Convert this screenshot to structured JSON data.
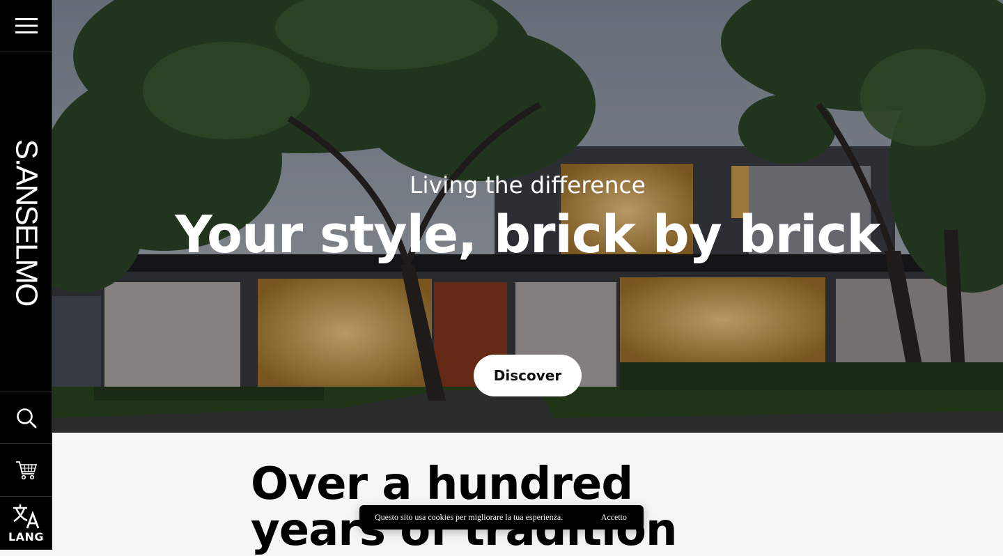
{
  "sidebar": {
    "logo": "S.ANSELMO",
    "lang_label": "LANG",
    "icons": {
      "menu": "hamburger-menu-icon",
      "search": "search-icon",
      "cart": "cart-icon",
      "lang": "translate-icon"
    }
  },
  "hero": {
    "subtitle": "Living the difference",
    "title": "Your style, brick by brick",
    "cta_label": "Discover"
  },
  "content": {
    "heading": "Over a hundred years of tradition"
  },
  "cookie": {
    "message": "Questo sito usa cookies per migliorare la tua esperienza.",
    "accept_label": "Accetto"
  },
  "colors": {
    "sidebar_bg": "#000000",
    "page_bg": "#f6f6f6",
    "button_bg": "#ffffff",
    "cookie_bg": "#000000"
  }
}
